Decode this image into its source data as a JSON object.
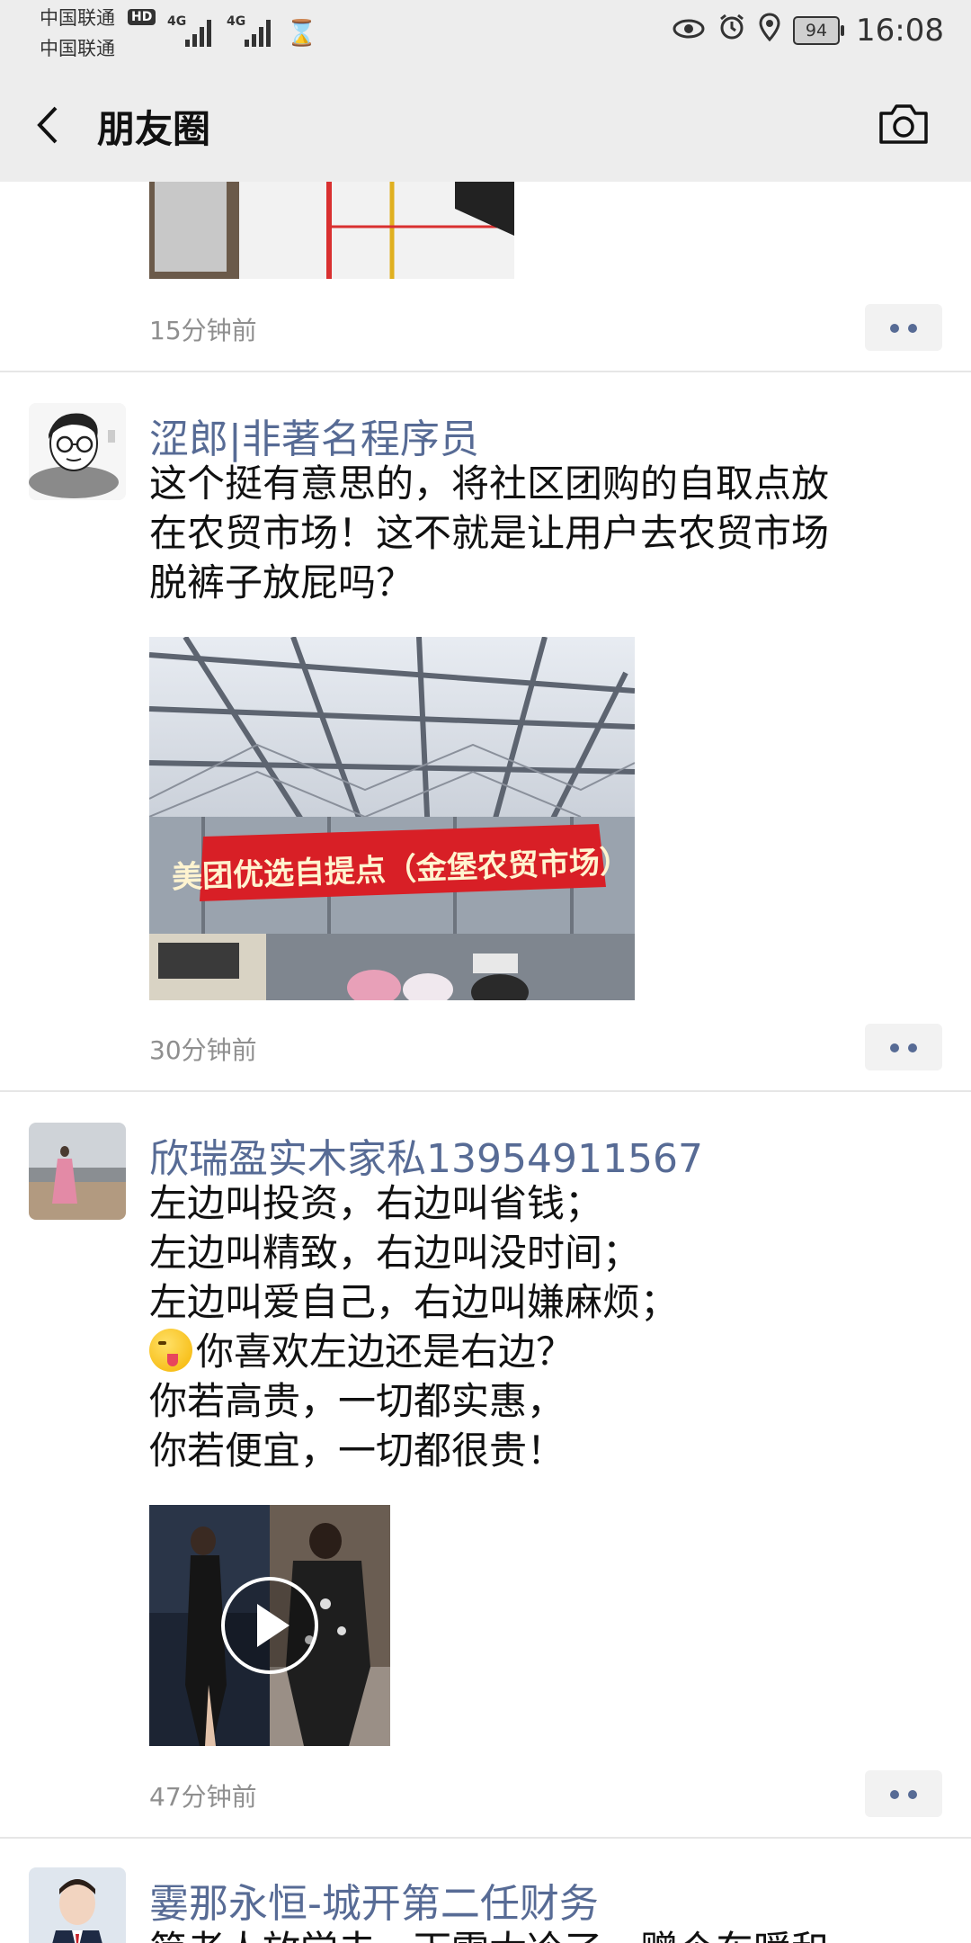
{
  "status_bar": {
    "carrier_1": "中国联通",
    "carrier_2": "中国联通",
    "hd_badge": "HD",
    "network_1": "4G",
    "network_2": "4G",
    "battery": "94",
    "time": "16:08"
  },
  "nav": {
    "title": "朋友圈",
    "back_icon": "chevron-left-icon",
    "camera_icon": "camera-icon"
  },
  "posts": [
    {
      "time": "15分钟前"
    },
    {
      "username": "涩郎|非著名程序员",
      "text": "这个挺有意思的，将社区团购的自取点放\n在农贸市场！这不就是让用户去农贸市场\n脱裤子放屁吗？",
      "photo_banner_text": "美团优选自提点（金堡农贸市场）",
      "time": "30分钟前"
    },
    {
      "username": "欣瑞盈实木家私13954911567",
      "text_lines": [
        "左边叫投资，右边叫省钱；",
        "左边叫精致，右边叫没时间；",
        "左边叫爱自己，右边叫嫌麻烦；",
        "你喜欢左边还是右边？",
        "你若高贵，一切都实惠，",
        "你若便宜，一切都很贵！"
      ],
      "emoji": "winking-face-with-tongue",
      "time": "47分钟前"
    },
    {
      "username": "霎那永恒-城开第二任财务",
      "text_partial": "简老人放学去，下雪太冷了，赠个车暖和"
    }
  ],
  "colors": {
    "username": "#576b95",
    "nav_bg": "#ededed",
    "timestamp": "#8f8f8f"
  }
}
